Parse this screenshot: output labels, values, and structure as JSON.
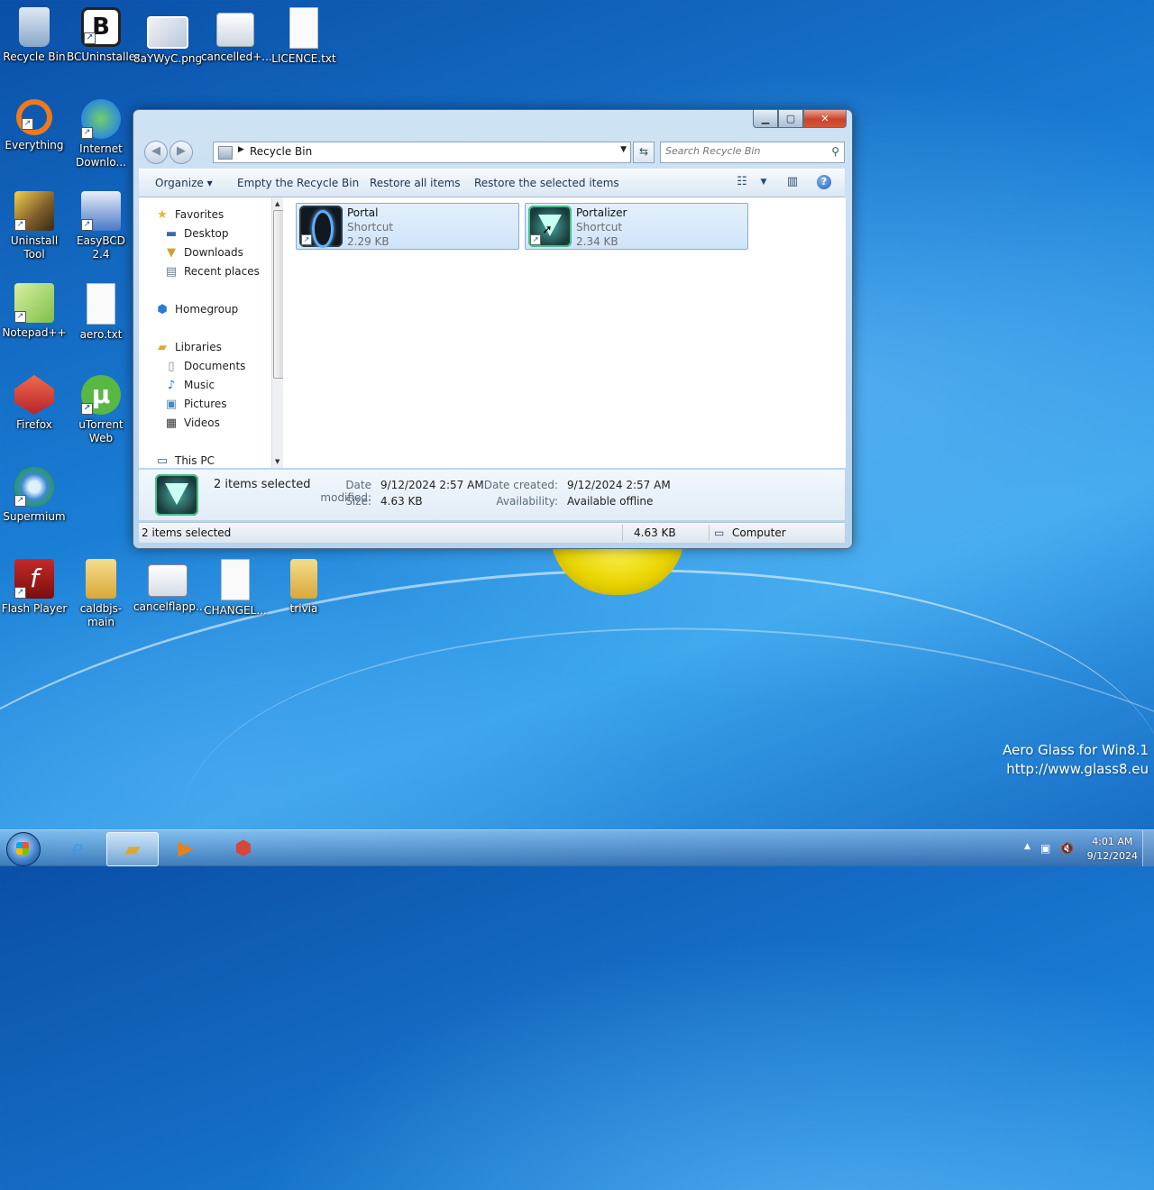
{
  "desktop": {
    "icons": [
      {
        "label": "Recycle Bin",
        "icon": "recycle-bin-icon",
        "color": "#9fb8d8"
      },
      {
        "label": "BCUninstaller",
        "icon": "bcuninstaller-icon",
        "color": "#e8e8e8"
      },
      {
        "label": "8aYWyC.png",
        "icon": "image-file-icon",
        "color": "#c9d3e6"
      },
      {
        "label": "cancelled+...",
        "icon": "settings-file-icon",
        "color": "#dde3ea"
      },
      {
        "label": "LICENCE.txt",
        "icon": "text-file-icon",
        "color": "#f4f4f4"
      },
      {
        "label": "Everything",
        "icon": "everything-icon",
        "color": "#f07a1a"
      },
      {
        "label": "Internet Downlo...",
        "icon": "idm-icon",
        "color": "#2f8ad8"
      },
      {
        "label": "Uninstall Tool",
        "icon": "uninstall-tool-icon",
        "color": "#7a5a2a"
      },
      {
        "label": "EasyBCD 2.4",
        "icon": "easybcd-icon",
        "color": "#4a78c8"
      },
      {
        "label": "Notepad++",
        "icon": "notepad-plus-plus-icon",
        "color": "#7fbf4a"
      },
      {
        "label": "aero.txt",
        "icon": "text-file-icon",
        "color": "#f4f4f4"
      },
      {
        "label": "Firefox",
        "icon": "firefox-icon",
        "color": "#d8453a"
      },
      {
        "label": "uTorrent Web",
        "icon": "utorrent-icon",
        "color": "#58b843"
      },
      {
        "label": "Supermium",
        "icon": "supermium-icon",
        "color": "#3a8ad0"
      },
      {
        "label": "Flash Player",
        "icon": "flash-player-icon",
        "color": "#9e1b1b"
      },
      {
        "label": "caldbjs-main",
        "icon": "folder-icon",
        "color": "#e8c66a"
      },
      {
        "label": "cancelflapp...",
        "icon": "window-file-icon",
        "color": "#e6ecf2"
      },
      {
        "label": "CHANGEL...",
        "icon": "text-file-icon",
        "color": "#f4f4f4"
      },
      {
        "label": "trivia",
        "icon": "folder-icon",
        "color": "#e8c66a"
      }
    ],
    "watermark_line1": "Aero Glass for Win8.1",
    "watermark_line2": "http://www.glass8.eu"
  },
  "window": {
    "address_path": "Recycle Bin",
    "search_placeholder": "Search Recycle Bin",
    "toolbar": {
      "organize": "Organize",
      "empty": "Empty the Recycle Bin",
      "restore_all": "Restore all items",
      "restore_selected": "Restore the selected items"
    },
    "nav": {
      "favorites": "Favorites",
      "desktop": "Desktop",
      "downloads": "Downloads",
      "recent": "Recent places",
      "homegroup": "Homegroup",
      "libraries": "Libraries",
      "documents": "Documents",
      "music": "Music",
      "pictures": "Pictures",
      "videos": "Videos",
      "thispc": "This PC"
    },
    "files": [
      {
        "name": "Portal",
        "type": "Shortcut",
        "size": "2.29 KB"
      },
      {
        "name": "Portalizer",
        "type": "Shortcut",
        "size": "2.34 KB"
      }
    ],
    "details": {
      "selected": "2 items selected",
      "date_modified_label": "Date modified:",
      "date_modified": "9/12/2024 2:57 AM",
      "size_label": "Size:",
      "size": "4.63 KB",
      "date_created_label": "Date created:",
      "date_created": "9/12/2024 2:57 AM",
      "availability_label": "Availability:",
      "availability": "Available offline"
    },
    "status": {
      "selected": "2 items selected",
      "size": "4.63 KB",
      "location": "Computer"
    }
  },
  "taskbar": {
    "time": "4:01 AM",
    "date": "9/12/2024"
  }
}
